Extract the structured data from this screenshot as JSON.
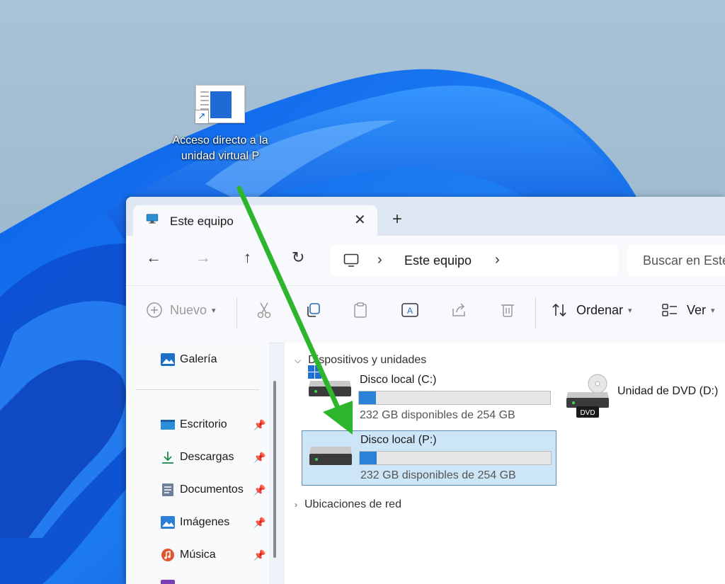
{
  "desktop": {
    "shortcut_label": "Acceso directo a la unidad virtual P"
  },
  "window": {
    "tab_title": "Este equipo",
    "nav": {
      "back": "←",
      "forward": "→",
      "up": "↑",
      "refresh": "↻"
    },
    "address": {
      "crumb": "Este equipo"
    },
    "search_placeholder": "Buscar en Este equipo",
    "toolbar": {
      "new_label": "Nuevo",
      "sort_label": "Ordenar",
      "view_label": "Ver"
    },
    "sidebar": {
      "items": [
        {
          "label": "Galería",
          "icon": "gallery-icon"
        },
        {
          "label": "Escritorio",
          "icon": "desktop-icon",
          "pinned": true
        },
        {
          "label": "Descargas",
          "icon": "download-icon",
          "pinned": true
        },
        {
          "label": "Documentos",
          "icon": "documents-icon",
          "pinned": true
        },
        {
          "label": "Imágenes",
          "icon": "pictures-icon",
          "pinned": true
        },
        {
          "label": "Música",
          "icon": "music-icon",
          "pinned": true
        }
      ]
    },
    "content": {
      "group_devices": "Dispositivos y unidades",
      "group_network": "Ubicaciones de red",
      "drives": [
        {
          "name": "Disco local (C:)",
          "free": "232 GB disponibles de 254 GB",
          "used_fraction": 0.09,
          "selected": false
        },
        {
          "name": "Disco local (P:)",
          "free": "232 GB disponibles de 254 GB",
          "used_fraction": 0.09,
          "selected": true
        }
      ],
      "dvd": {
        "name": "Unidad de DVD (D:)",
        "badge": "DVD"
      }
    }
  },
  "colors": {
    "accent": "#2a82d7",
    "selection": "#cde6f7",
    "annotation_arrow": "#2db52d"
  }
}
